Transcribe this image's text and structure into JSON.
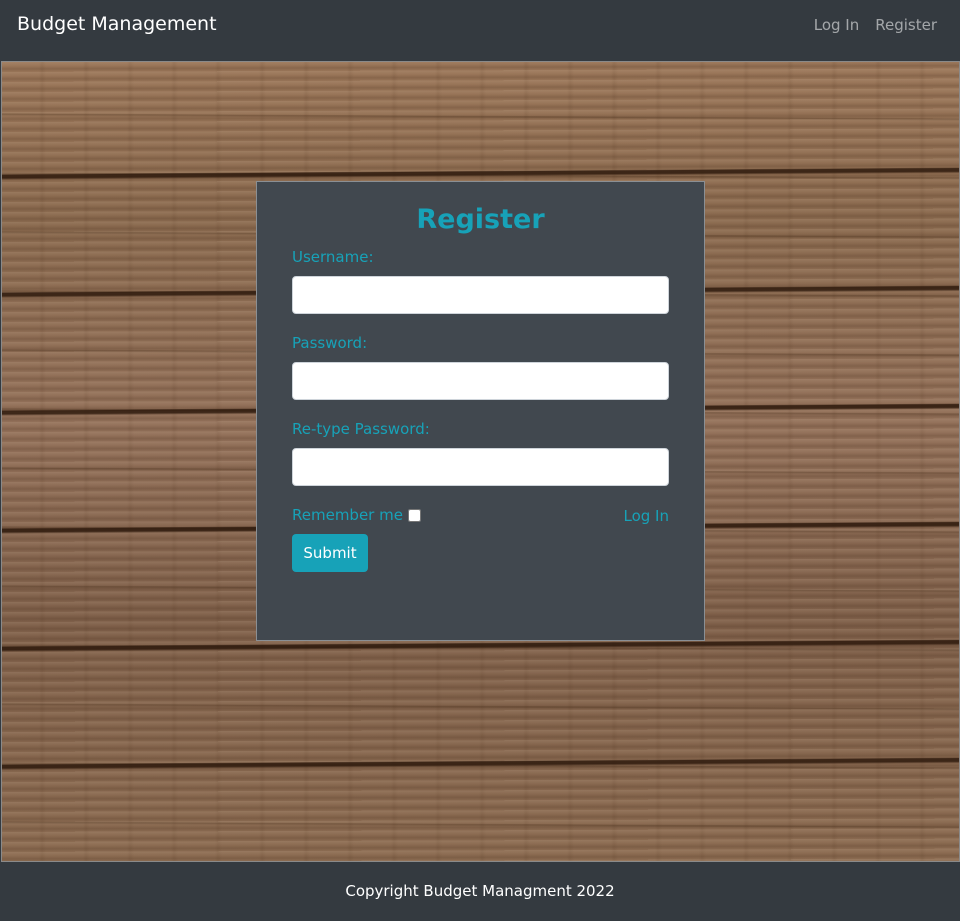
{
  "navbar": {
    "brand": "Budget Management",
    "links": [
      {
        "label": "Log In"
      },
      {
        "label": "Register"
      }
    ]
  },
  "form": {
    "title": "Register",
    "username": {
      "label": "Username:",
      "value": "",
      "placeholder": ""
    },
    "password": {
      "label": "Password:",
      "value": "",
      "placeholder": ""
    },
    "retype_password": {
      "label": "Re-type Password:",
      "value": "",
      "placeholder": ""
    },
    "remember_me": {
      "label": "Remember me",
      "checked": false
    },
    "login_link": "Log In",
    "submit_label": "Submit"
  },
  "footer": {
    "text": "Copyright Budget Managment 2022"
  },
  "colors": {
    "accent": "#17a2b8",
    "navbar_bg": "#343a40",
    "card_bg": "#41484f"
  }
}
